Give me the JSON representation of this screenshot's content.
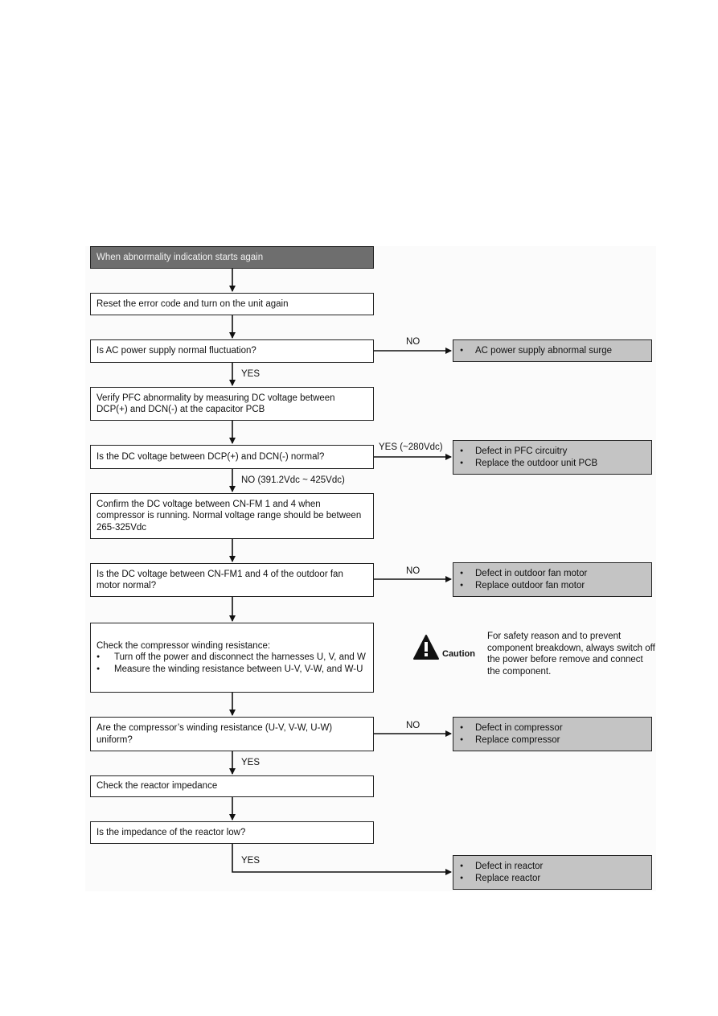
{
  "flowchart": {
    "start": "When abnormality indication starts again",
    "steps": [
      {
        "id": "reset",
        "text": "Reset the error code and turn on the unit again"
      },
      {
        "id": "ac-check",
        "text": "Is AC power supply normal fluctuation?"
      },
      {
        "id": "verify-pfc",
        "text": "Verify PFC abnormality by measuring DC voltage between DCP(+) and DCN(-) at the capacitor PCB"
      },
      {
        "id": "dc-check",
        "text": "Is the DC voltage between DCP(+) and DCN(-) normal?"
      },
      {
        "id": "confirm-fm",
        "text": "Confirm the DC voltage between CN-FM 1 and 4 when compressor is running. Normal voltage range should be between 265-325Vdc"
      },
      {
        "id": "fm-check",
        "text": "Is the DC voltage between CN-FM1 and 4 of the outdoor fan motor normal?"
      },
      {
        "id": "winding",
        "title": "Check the compressor winding resistance:",
        "bullets": [
          "Turn off the power and disconnect the harnesses U, V, and W",
          "Measure the winding resistance between U-V, V-W, and W-U"
        ]
      },
      {
        "id": "winding-check",
        "text": "Are the compressor’s winding resistance (U-V, V-W, U-W) uniform?"
      },
      {
        "id": "reactor",
        "text": "Check the reactor impedance"
      },
      {
        "id": "reactor-check",
        "text": "Is the impedance of the reactor low?"
      }
    ],
    "outcomes": [
      {
        "id": "ac-surge",
        "bullets": [
          "AC power supply abnormal surge"
        ]
      },
      {
        "id": "pfc-defect",
        "bullets": [
          "Defect in PFC circuitry",
          "Replace the outdoor unit PCB"
        ]
      },
      {
        "id": "fan-defect",
        "bullets": [
          "Defect in outdoor fan motor",
          "Replace outdoor fan motor"
        ]
      },
      {
        "id": "comp-defect",
        "bullets": [
          "Defect in compressor",
          "Replace compressor"
        ]
      },
      {
        "id": "reactor-defect",
        "bullets": [
          "Defect in reactor",
          "Replace reactor"
        ]
      }
    ],
    "edge_labels": {
      "ac_no": "NO",
      "ac_yes": "YES",
      "dc_yes": "YES (~280Vdc)",
      "dc_no": "NO (391.2Vdc ~ 425Vdc)",
      "fm_no": "NO",
      "winding_no": "NO",
      "winding_yes": "YES",
      "reactor_yes": "YES"
    },
    "caution": {
      "icon": "warning-triangle-icon",
      "label": "Caution",
      "text": "For safety reason and to prevent component breakdown, always switch off the power before remove and connect the component."
    },
    "colors": {
      "start_fill": "#6e6e6e",
      "outcome_fill": "#c4c4c4",
      "step_fill": "#ffffff",
      "line": "#222222"
    }
  }
}
